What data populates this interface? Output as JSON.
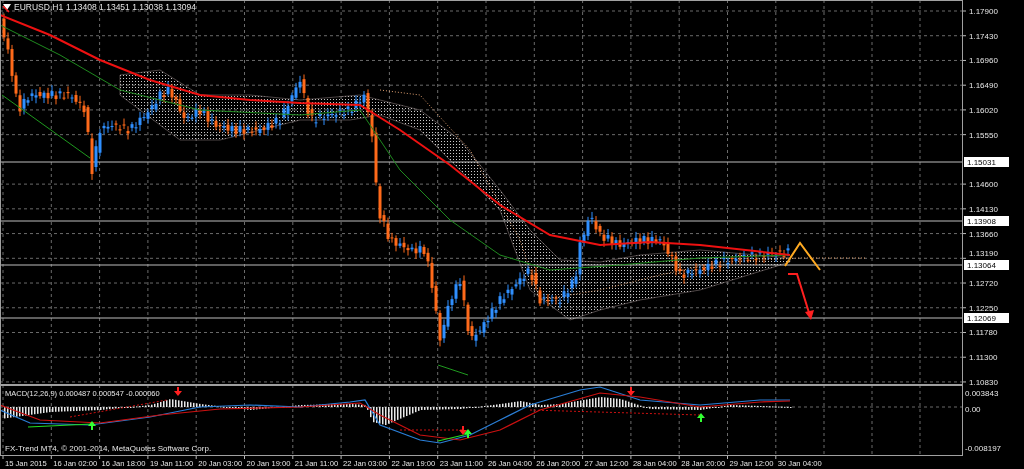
{
  "chart_header": {
    "symbol": "EURUSD,H1",
    "quotes": "1.13408 1.13451 1.13038 1.13094"
  },
  "price_axis": {
    "ticks": [
      "1.17900",
      "1.17430",
      "1.16960",
      "1.16490",
      "1.16020",
      "1.15550",
      "1.14600",
      "1.14130",
      "1.13660",
      "1.13190",
      "1.12720",
      "1.12250",
      "1.11780",
      "1.11300",
      "1.10830"
    ],
    "levels": [
      "1.15031",
      "1.13908",
      "1.13064",
      "1.12069"
    ]
  },
  "macd": {
    "label": "MACD(12,26,9) 0.000487 0.000547 -0.000060",
    "ticks": [
      "0.003843",
      "0.00",
      "-0.008197"
    ]
  },
  "copyright": "FX-Trend MT4, © 2001-2014, MetaQuotes Software Corp.",
  "time_axis": {
    "labels": [
      "15 Jan 2015",
      "16 Jan 02:00",
      "16 Jan 18:00",
      "19 Jan 11:00",
      "20 Jan 03:00",
      "20 Jan 19:00",
      "21 Jan 11:00",
      "22 Jan 03:00",
      "22 Jan 19:00",
      "23 Jan 11:00",
      "26 Jan 04:00",
      "26 Jan 20:00",
      "27 Jan 12:00",
      "28 Jan 04:00",
      "28 Jan 20:00",
      "29 Jan 12:00",
      "30 Jan 04:00"
    ]
  }
}
